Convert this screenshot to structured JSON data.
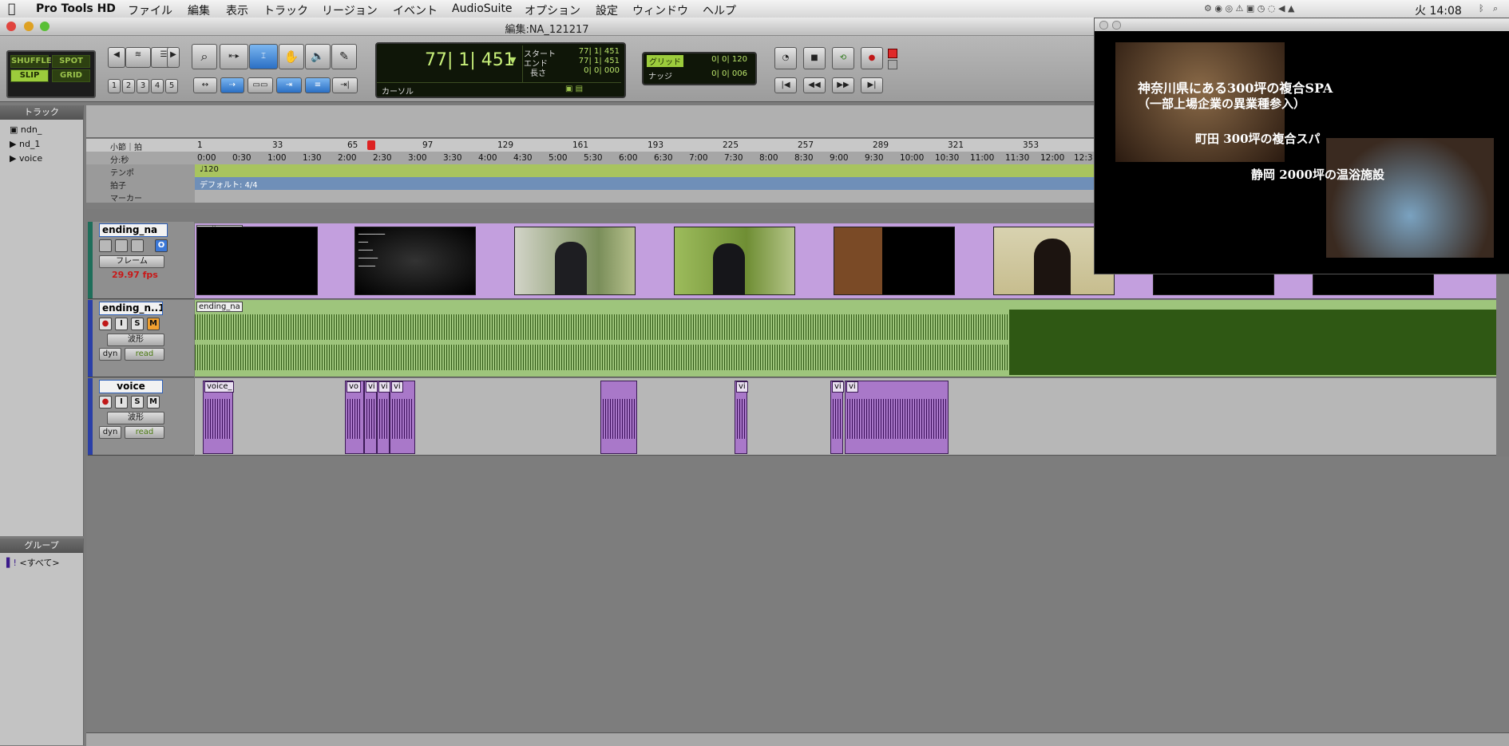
{
  "menubar": {
    "app_name": "Pro Tools HD",
    "items": [
      "ファイル",
      "編集",
      "表示",
      "トラック",
      "リージョン",
      "イベント",
      "AudioSuite",
      "オプション",
      "設定",
      "ウィンドウ",
      "ヘルプ"
    ],
    "clock": "火 14:08"
  },
  "window": {
    "title": "編集:NA_121217"
  },
  "edit_modes": {
    "shuffle": "SHUFFLE",
    "spot": "SPOT",
    "slip": "SLIP",
    "grid": "GRID"
  },
  "zoom_presets": [
    "1",
    "2",
    "3",
    "4",
    "5"
  ],
  "main_counter": {
    "value": "77| 1| 451",
    "start_label": "スタート",
    "end_label": "エンド",
    "length_label": "長さ",
    "start": "77| 1| 451",
    "end": "77| 1| 451",
    "length": "0| 0| 000",
    "cursor_label": "カーソル"
  },
  "grid_nudge": {
    "grid_label": "グリッド",
    "grid_value": "0| 0| 120",
    "nudge_label": "ナッジ",
    "nudge_value": "0| 0| 006"
  },
  "tracks_panel": {
    "title": "トラック",
    "items": [
      "ndn_",
      "nd_1",
      "voice"
    ]
  },
  "groups_panel": {
    "title": "グループ",
    "items": [
      "<すべて>"
    ]
  },
  "rulers": {
    "bars_label": "小節｜拍",
    "time_label": "分:秒",
    "tempo_label": "テンポ",
    "meter_label": "拍子",
    "marker_label": "マーカー",
    "bars": [
      "1",
      "33",
      "65",
      "97",
      "129",
      "161",
      "193",
      "225",
      "257",
      "289",
      "321",
      "353"
    ],
    "times": [
      "0:00",
      "0:30",
      "1:00",
      "1:30",
      "2:00",
      "2:30",
      "3:00",
      "3:30",
      "4:00",
      "4:30",
      "5:00",
      "5:30",
      "6:00",
      "6:30",
      "7:00",
      "7:30",
      "8:00",
      "8:30",
      "9:00",
      "9:30",
      "10:00",
      "10:30",
      "11:00",
      "11:30",
      "12:00",
      "12:3"
    ],
    "tempo_value": "♩120",
    "meter_value": "デフォルト: 4/4"
  },
  "video_track": {
    "name": "ending_na",
    "clip_name": "ending_na",
    "view": "フレーム",
    "fps": "29.97 fps"
  },
  "audio_track_1": {
    "name": "ending_n..1",
    "clip_name": "ending_na",
    "view": "波形",
    "dyn": "dyn",
    "automation": "read"
  },
  "voice_track": {
    "name": "voice",
    "view": "波形",
    "dyn": "dyn",
    "automation": "read",
    "clips": [
      "voice_",
      "vo",
      "vi",
      "vi",
      "vi",
      "vi",
      "vi",
      "vi"
    ]
  },
  "track_buttons": {
    "rec": "●",
    "input": "I",
    "solo": "S",
    "mute": "M"
  },
  "preview": {
    "line1": "神奈川県にある300坪の複合SPA",
    "line2": "（一部上場企業の異業種参入）",
    "line3": "町田 300坪の複合スパ",
    "line4": "静岡 2000坪の温浴施設"
  },
  "colors": {
    "accent_green": "#9ccc3c",
    "audio_waveform_bg": "#9ec57c",
    "audio_waveform": "#2f5814",
    "voice_clip": "#a978c9",
    "tempo_lane": "#a8c45f",
    "meter_lane": "#6f8fb8"
  }
}
